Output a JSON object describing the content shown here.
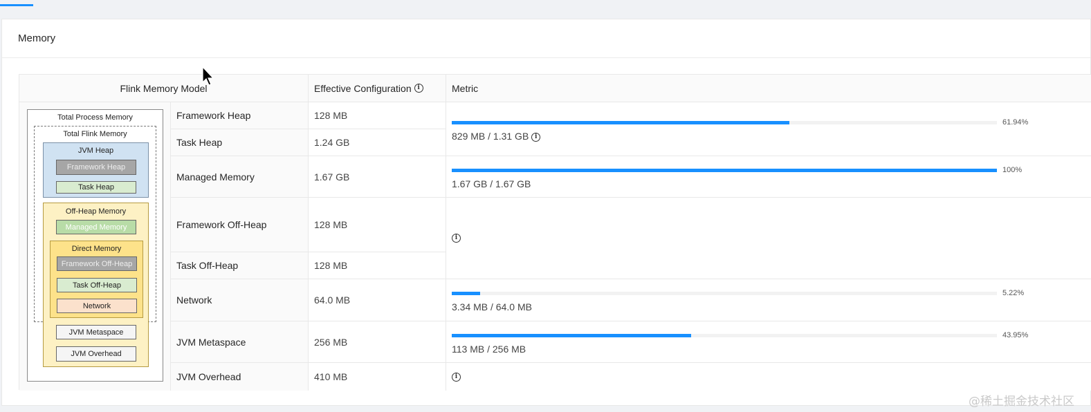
{
  "card": {
    "title": "Memory"
  },
  "headers": {
    "model": "Flink Memory Model",
    "config": "Effective Configuration",
    "metric": "Metric"
  },
  "diagram": {
    "total_process": "Total Process Memory",
    "total_flink": "Total Flink Memory",
    "jvm_heap": "JVM Heap",
    "framework_heap": "Framework Heap",
    "task_heap": "Task Heap",
    "off_heap": "Off-Heap Memory",
    "managed": "Managed Memory",
    "direct": "Direct Memory",
    "framework_off_heap": "Framework Off-Heap",
    "task_off_heap": "Task Off-Heap",
    "network": "Network",
    "jvm_metaspace": "JVM Metaspace",
    "jvm_overhead": "JVM Overhead"
  },
  "rows": [
    {
      "name": "Framework Heap",
      "value": "128 MB"
    },
    {
      "name": "Task Heap",
      "value": "1.24 GB"
    },
    {
      "name": "Managed Memory",
      "value": "1.67 GB"
    },
    {
      "name": "Framework Off-Heap",
      "value": "128 MB"
    },
    {
      "name": "Task Off-Heap",
      "value": "128 MB"
    },
    {
      "name": "Network",
      "value": "64.0 MB"
    },
    {
      "name": "JVM Metaspace",
      "value": "256 MB"
    },
    {
      "name": "JVM Overhead",
      "value": "410 MB"
    }
  ],
  "metrics": {
    "heap": {
      "percent": 61.94,
      "percent_label": "61.94%",
      "used": "829 MB / 1.31 GB"
    },
    "managed": {
      "percent": 100,
      "percent_label": "100%",
      "used": "1.67 GB / 1.67 GB"
    },
    "network": {
      "percent": 5.22,
      "percent_label": "5.22%",
      "used": "3.34 MB / 64.0 MB"
    },
    "metaspace": {
      "percent": 43.95,
      "percent_label": "43.95%",
      "used": "113 MB / 256 MB"
    }
  },
  "info_glyph": "i",
  "watermark": "@稀土掘金技术社区",
  "colors": {
    "accent": "#1890ff"
  }
}
